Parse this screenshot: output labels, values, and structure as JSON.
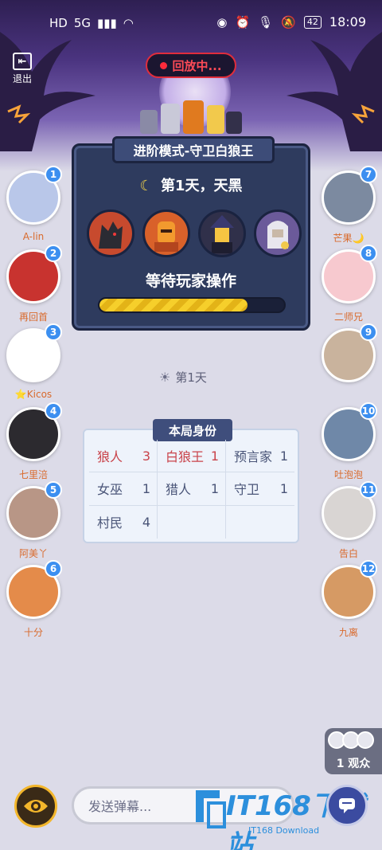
{
  "status_bar": {
    "left_icons": [
      "HD",
      "5G"
    ],
    "battery": "42",
    "time": "18:09"
  },
  "exit": {
    "label": "退出"
  },
  "replay": {
    "label": "回放中..."
  },
  "panel": {
    "mode_title": "进阶模式-守卫白狼王",
    "day_text": "第1天，天黑",
    "wait_text": "等待玩家操作",
    "progress": 0.8,
    "roles": [
      "werewolf-role-icon",
      "guard-role-icon",
      "witch-role-icon",
      "seer-role-icon"
    ]
  },
  "players_left": [
    {
      "seat": "1",
      "name": "A-lin",
      "color": "#b9c7e9"
    },
    {
      "seat": "2",
      "name": "再回首",
      "color": "#c8332f"
    },
    {
      "seat": "3",
      "name": "⭐Kicos",
      "color": "#ffffff"
    },
    {
      "seat": "4",
      "name": "七里涪",
      "color": "#2c2a2f"
    },
    {
      "seat": "5",
      "name": "阿美丫",
      "color": "#b89686"
    },
    {
      "seat": "6",
      "name": "十分",
      "color": "#e48b4a"
    }
  ],
  "players_right": [
    {
      "seat": "7",
      "name": "芒果🌙",
      "color": "#7c8aa0"
    },
    {
      "seat": "8",
      "name": "二师兄",
      "color": "#f7c9cf"
    },
    {
      "seat": "9",
      "name": "",
      "color": "#c9b39d"
    },
    {
      "seat": "10",
      "name": "吐泡泡",
      "color": "#6f88a8"
    },
    {
      "seat": "11",
      "name": "告白",
      "color": "#d9d5d3"
    },
    {
      "seat": "12",
      "name": "九离",
      "color": "#d69a64"
    }
  ],
  "day_label": "第1天",
  "roles_card": {
    "title": "本局身份",
    "cells": [
      {
        "name": "狼人",
        "count": "3",
        "red": true
      },
      {
        "name": "白狼王",
        "count": "1",
        "red": true
      },
      {
        "name": "预言家",
        "count": "1",
        "red": false
      },
      {
        "name": "女巫",
        "count": "1",
        "red": false
      },
      {
        "name": "猎人",
        "count": "1",
        "red": false
      },
      {
        "name": "守卫",
        "count": "1",
        "red": false
      },
      {
        "name": "村民",
        "count": "4",
        "red": false
      },
      {
        "name": "",
        "count": "",
        "red": false
      },
      {
        "name": "",
        "count": "",
        "red": false
      }
    ]
  },
  "audience": {
    "count_label": "1 观众"
  },
  "bottom": {
    "danmu_placeholder": "发送弹幕..."
  },
  "watermark": {
    "text": "IT168下载站",
    "sub": "IT168 Download"
  }
}
